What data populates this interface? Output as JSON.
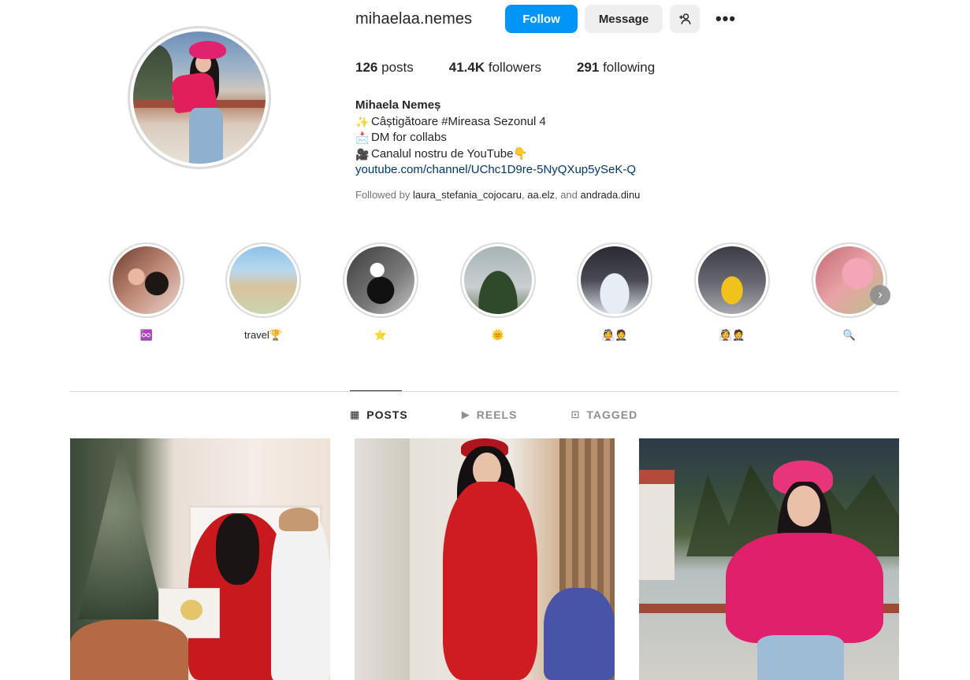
{
  "profile": {
    "username": "mihaelaa.nemes",
    "follow_label": "Follow",
    "message_label": "Message",
    "add_user_icon": "add-user-icon",
    "more_label": "•••",
    "stats": {
      "posts_count": "126",
      "posts_label": "posts",
      "followers_count": "41.4K",
      "followers_label": "followers",
      "following_count": "291",
      "following_label": "following"
    },
    "full_name": "Mihaela Nemeș",
    "bio_lines": [
      {
        "emoji": "✨",
        "text": "Câștigătoare #Mireasa Sezonul 4"
      },
      {
        "emoji": "📩",
        "text": "DM for collabs"
      },
      {
        "emoji": "🎥",
        "text": "Canalul nostru de YouTube👇"
      }
    ],
    "link": "youtube.com/channel/UChc1D9re-5NyQXup5ySeK-Q",
    "followed_prefix": "Followed by ",
    "followed_users": [
      "laura_stefania_cojocaru",
      "aa.elz"
    ],
    "followed_and": ", and ",
    "followed_last": "andrada.dinu",
    "followed_sep": ", "
  },
  "highlights": [
    {
      "label": "♾️"
    },
    {
      "label": "travel🏆"
    },
    {
      "label": "⭐"
    },
    {
      "label": "🌞"
    },
    {
      "label": "👰🤵"
    },
    {
      "label": "👰🤵"
    },
    {
      "label": "🔍"
    }
  ],
  "tabs": [
    {
      "label": "POSTS",
      "icon": "grid-icon",
      "glyph": "▦"
    },
    {
      "label": "REELS",
      "icon": "reels-icon",
      "glyph": "▶"
    },
    {
      "label": "TAGGED",
      "icon": "tagged-icon",
      "glyph": "⊡"
    }
  ],
  "colors": {
    "primary": "#0095f6",
    "text": "#262626",
    "muted": "#737373",
    "link": "#00376b",
    "button_bg": "#efefef"
  }
}
